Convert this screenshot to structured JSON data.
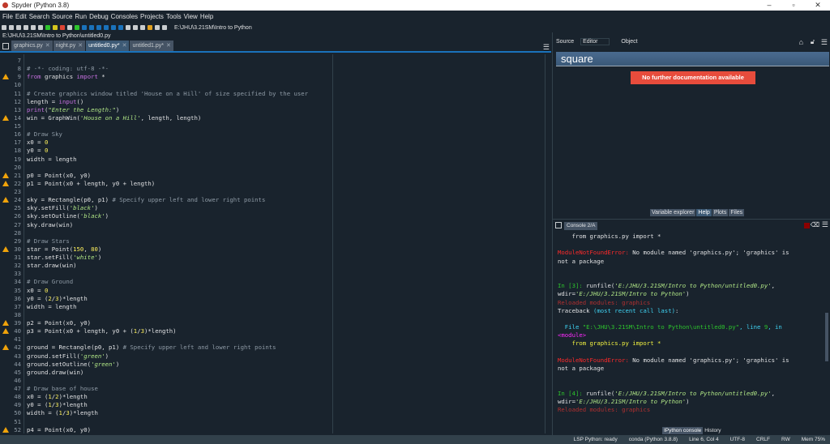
{
  "window": {
    "title": "Spyder (Python 3.8)",
    "minimize": "–",
    "restore": "▫",
    "close": "✕"
  },
  "menu": [
    "File",
    "Edit",
    "Search",
    "Source",
    "Run",
    "Debug",
    "Consoles",
    "Projects",
    "Tools",
    "View",
    "Help"
  ],
  "toolbar": {
    "working_dir": "E:\\JHU\\3.21SM\\Intro to Python"
  },
  "editor": {
    "file_path": "E:\\JHU\\3.21SM\\Intro to Python\\untitled0.py",
    "tabs": [
      {
        "label": "graphics.py",
        "active": false
      },
      {
        "label": "night.py",
        "active": false
      },
      {
        "label": "untitled0.py*",
        "active": true
      },
      {
        "label": "untitled1.py*",
        "active": false
      }
    ],
    "lines": [
      {
        "n": 7,
        "t": []
      },
      {
        "n": 8,
        "t": [
          [
            "c",
            "# -*- coding: utf-8 -*-"
          ]
        ]
      },
      {
        "n": 9,
        "w": true,
        "t": [
          [
            "k",
            "from"
          ],
          [
            "p",
            " graphics "
          ],
          [
            "k",
            "import"
          ],
          [
            "p",
            " *"
          ]
        ]
      },
      {
        "n": 10,
        "t": []
      },
      {
        "n": 11,
        "t": [
          [
            "c",
            "# Create graphics window titled 'House on a Hill' of size specified by the user"
          ]
        ]
      },
      {
        "n": 12,
        "t": [
          [
            "p",
            "length = "
          ],
          [
            "k",
            "input"
          ],
          [
            "p",
            "()"
          ]
        ]
      },
      {
        "n": 13,
        "t": [
          [
            "k",
            "print"
          ],
          [
            "p",
            "("
          ],
          [
            "s",
            "\"Enter the Length:\""
          ],
          [
            "p",
            ")"
          ]
        ]
      },
      {
        "n": 14,
        "w": true,
        "t": [
          [
            "p",
            "win = GraphWin("
          ],
          [
            "s",
            "'House on a Hill'"
          ],
          [
            "p",
            ", length, length)"
          ]
        ]
      },
      {
        "n": 15,
        "t": []
      },
      {
        "n": 16,
        "t": [
          [
            "c",
            "# Draw Sky"
          ]
        ]
      },
      {
        "n": 17,
        "t": [
          [
            "p",
            "x0 = "
          ],
          [
            "n",
            "0"
          ]
        ]
      },
      {
        "n": 18,
        "t": [
          [
            "p",
            "y0 = "
          ],
          [
            "n",
            "0"
          ]
        ]
      },
      {
        "n": 19,
        "t": [
          [
            "p",
            "width = length"
          ]
        ]
      },
      {
        "n": 20,
        "t": []
      },
      {
        "n": 21,
        "w": true,
        "t": [
          [
            "p",
            "p0 = Point(x0, y0)"
          ]
        ]
      },
      {
        "n": 22,
        "w": true,
        "t": [
          [
            "p",
            "p1 = Point(x0 + length, y0 + length)"
          ]
        ]
      },
      {
        "n": 23,
        "t": []
      },
      {
        "n": 24,
        "w": true,
        "t": [
          [
            "p",
            "sky = Rectangle(p0, p1) "
          ],
          [
            "c",
            "# Specify upper left and lower right points"
          ]
        ]
      },
      {
        "n": 25,
        "t": [
          [
            "p",
            "sky.setFill("
          ],
          [
            "s",
            "'black'"
          ],
          [
            "p",
            ")"
          ]
        ]
      },
      {
        "n": 26,
        "t": [
          [
            "p",
            "sky.setOutline("
          ],
          [
            "s",
            "'black'"
          ],
          [
            "p",
            ")"
          ]
        ]
      },
      {
        "n": 27,
        "t": [
          [
            "p",
            "sky.draw(win)"
          ]
        ]
      },
      {
        "n": 28,
        "t": []
      },
      {
        "n": 29,
        "t": [
          [
            "c",
            "# Draw Stars"
          ]
        ]
      },
      {
        "n": 30,
        "w": true,
        "t": [
          [
            "p",
            "star = Point("
          ],
          [
            "n",
            "150"
          ],
          [
            "p",
            ", "
          ],
          [
            "n",
            "80"
          ],
          [
            "p",
            ")"
          ]
        ]
      },
      {
        "n": 31,
        "t": [
          [
            "p",
            "star.setFill("
          ],
          [
            "s",
            "'white'"
          ],
          [
            "p",
            ")"
          ]
        ]
      },
      {
        "n": 32,
        "t": [
          [
            "p",
            "star.draw(win)"
          ]
        ]
      },
      {
        "n": 33,
        "t": []
      },
      {
        "n": 34,
        "t": [
          [
            "c",
            "# Draw Ground"
          ]
        ]
      },
      {
        "n": 35,
        "t": [
          [
            "p",
            "x0 = "
          ],
          [
            "n",
            "0"
          ]
        ]
      },
      {
        "n": 36,
        "t": [
          [
            "p",
            "y0 = ("
          ],
          [
            "n",
            "2"
          ],
          [
            "p",
            "/"
          ],
          [
            "n",
            "3"
          ],
          [
            "p",
            ")*length"
          ]
        ]
      },
      {
        "n": 37,
        "t": [
          [
            "p",
            "width = length"
          ]
        ]
      },
      {
        "n": 38,
        "t": []
      },
      {
        "n": 39,
        "w": true,
        "t": [
          [
            "p",
            "p2 = Point(x0, y0)"
          ]
        ]
      },
      {
        "n": 40,
        "w": true,
        "t": [
          [
            "p",
            "p3 = Point(x0 + length, y0 + ("
          ],
          [
            "n",
            "1"
          ],
          [
            "p",
            "/"
          ],
          [
            "n",
            "3"
          ],
          [
            "p",
            ")*length)"
          ]
        ]
      },
      {
        "n": 41,
        "t": []
      },
      {
        "n": 42,
        "w": true,
        "t": [
          [
            "p",
            "ground = Rectangle(p0, p1) "
          ],
          [
            "c",
            "# Specify upper left and lower right points"
          ]
        ]
      },
      {
        "n": 43,
        "t": [
          [
            "p",
            "ground.setFill("
          ],
          [
            "s",
            "'green'"
          ],
          [
            "p",
            ")"
          ]
        ]
      },
      {
        "n": 44,
        "t": [
          [
            "p",
            "ground.setOutline("
          ],
          [
            "s",
            "'green'"
          ],
          [
            "p",
            ")"
          ]
        ]
      },
      {
        "n": 45,
        "t": [
          [
            "p",
            "ground.draw(win)"
          ]
        ]
      },
      {
        "n": 46,
        "t": []
      },
      {
        "n": 47,
        "t": [
          [
            "c",
            "# Draw base of house"
          ]
        ]
      },
      {
        "n": 48,
        "t": [
          [
            "p",
            "x0 = ("
          ],
          [
            "n",
            "1"
          ],
          [
            "p",
            "/"
          ],
          [
            "n",
            "2"
          ],
          [
            "p",
            ")*length"
          ]
        ]
      },
      {
        "n": 49,
        "t": [
          [
            "p",
            "y0 = ("
          ],
          [
            "n",
            "1"
          ],
          [
            "p",
            "/"
          ],
          [
            "n",
            "3"
          ],
          [
            "p",
            ")*length"
          ]
        ]
      },
      {
        "n": 50,
        "t": [
          [
            "p",
            "width = ("
          ],
          [
            "n",
            "1"
          ],
          [
            "p",
            "/"
          ],
          [
            "n",
            "3"
          ],
          [
            "p",
            ")*length"
          ]
        ]
      },
      {
        "n": 51,
        "t": []
      },
      {
        "n": 52,
        "w": true,
        "t": [
          [
            "p",
            "p4 = Point(x0, y0)"
          ]
        ]
      }
    ]
  },
  "help": {
    "source_label": "Source",
    "source_value": "Editor",
    "object_label": "Object",
    "title": "square",
    "message": "No further documentation available",
    "pane_tabs": [
      {
        "label": "Variable explorer",
        "active": false
      },
      {
        "label": "Help",
        "active": true
      },
      {
        "label": "Plots",
        "active": false
      },
      {
        "label": "Files",
        "active": false
      }
    ]
  },
  "console": {
    "tab": "Console 2/A",
    "lines": [
      [
        [
          "wht",
          "    from graphics.py import *"
        ]
      ],
      [],
      [
        [
          "err",
          "ModuleNotFoundError:"
        ],
        [
          "wht",
          " No module named 'graphics.py'; 'graphics' is"
        ]
      ],
      [
        [
          "wht",
          "not a package"
        ]
      ],
      [],
      [],
      [
        [
          "grn",
          "In [3]: "
        ],
        [
          "wht",
          "runfile("
        ],
        [
          "gi",
          "'E:/JHU/3.21SM/Intro to Python/untitled0.py'"
        ],
        [
          "wht",
          ","
        ]
      ],
      [
        [
          "wht",
          "wdir="
        ],
        [
          "gi",
          "'E:/JHU/3.21SM/Intro to Python'"
        ],
        [
          "wht",
          ")"
        ]
      ],
      [
        [
          "dred",
          "Reloaded modules: graphics"
        ]
      ],
      [
        [
          "wht",
          "Traceback "
        ],
        [
          "cyan",
          "(most recent call last)"
        ],
        [
          "wht",
          ":"
        ]
      ],
      [],
      [
        [
          "cyan",
          "  File "
        ],
        [
          "grn",
          "\"E:\\JHU\\3.21SM\\Intro to Python\\untitled0.py\""
        ],
        [
          "cyan",
          ", line "
        ],
        [
          "grn",
          "9"
        ],
        [
          "cyan",
          ", in"
        ]
      ],
      [
        [
          "mag",
          "<module>"
        ]
      ],
      [
        [
          "yel",
          "    from graphics.py import *"
        ]
      ],
      [],
      [
        [
          "err",
          "ModuleNotFoundError:"
        ],
        [
          "wht",
          " No module named 'graphics.py'; 'graphics' is"
        ]
      ],
      [
        [
          "wht",
          "not a package"
        ]
      ],
      [],
      [],
      [
        [
          "grn",
          "In [4]: "
        ],
        [
          "wht",
          "runfile("
        ],
        [
          "gi",
          "'E:/JHU/3.21SM/Intro to Python/untitled0.py'"
        ],
        [
          "wht",
          ","
        ]
      ],
      [
        [
          "wht",
          "wdir="
        ],
        [
          "gi",
          "'E:/JHU/3.21SM/Intro to Python'"
        ],
        [
          "wht",
          ")"
        ]
      ],
      [
        [
          "dred",
          "Reloaded modules: graphics"
        ]
      ]
    ],
    "bottom_tabs": [
      {
        "label": "IPython console",
        "active": true
      },
      {
        "label": "History",
        "active": false
      }
    ]
  },
  "status": {
    "lsp": "LSP Python: ready",
    "conda": "conda (Python 3.8.8)",
    "position": "Line 6, Col 4",
    "encoding": "UTF-8",
    "eol": "CRLF",
    "mode": "RW",
    "memory": "Mem 75%"
  }
}
